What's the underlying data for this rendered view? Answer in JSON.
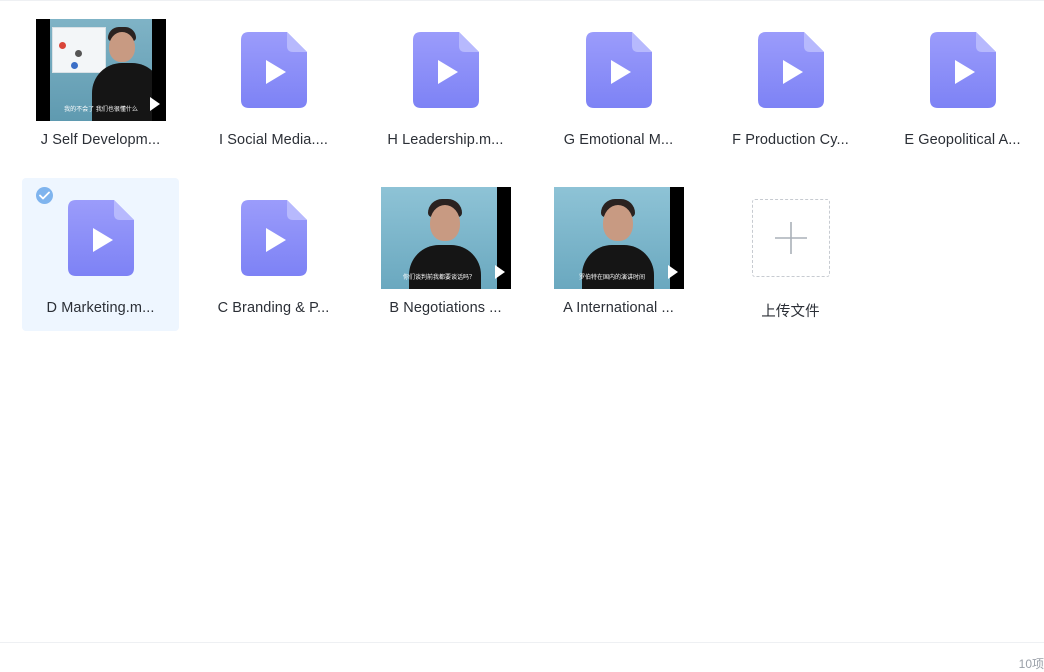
{
  "files": [
    {
      "name": "J Self Developm...",
      "type": "thumb",
      "variant": "lecture"
    },
    {
      "name": "I Social Media....",
      "type": "video"
    },
    {
      "name": "H Leadership.m...",
      "type": "video"
    },
    {
      "name": "G Emotional M...",
      "type": "video"
    },
    {
      "name": "F Production Cy...",
      "type": "video"
    },
    {
      "name": "E Geopolitical A...",
      "type": "video"
    },
    {
      "name": "D Marketing.m...",
      "type": "video",
      "selected": true
    },
    {
      "name": "C Branding & P...",
      "type": "video"
    },
    {
      "name": "B Negotiations ...",
      "type": "thumb",
      "variant": "interview"
    },
    {
      "name": "A International ...",
      "type": "thumb",
      "variant": "interview"
    }
  ],
  "upload": {
    "label": "上传文件"
  },
  "footer": {
    "count": "10项"
  },
  "colors": {
    "file_icon_top": "#9b9cfb",
    "file_icon_bottom": "#7d82f5",
    "selected_bg": "#eef6ff",
    "check": "#7fb4ee"
  }
}
